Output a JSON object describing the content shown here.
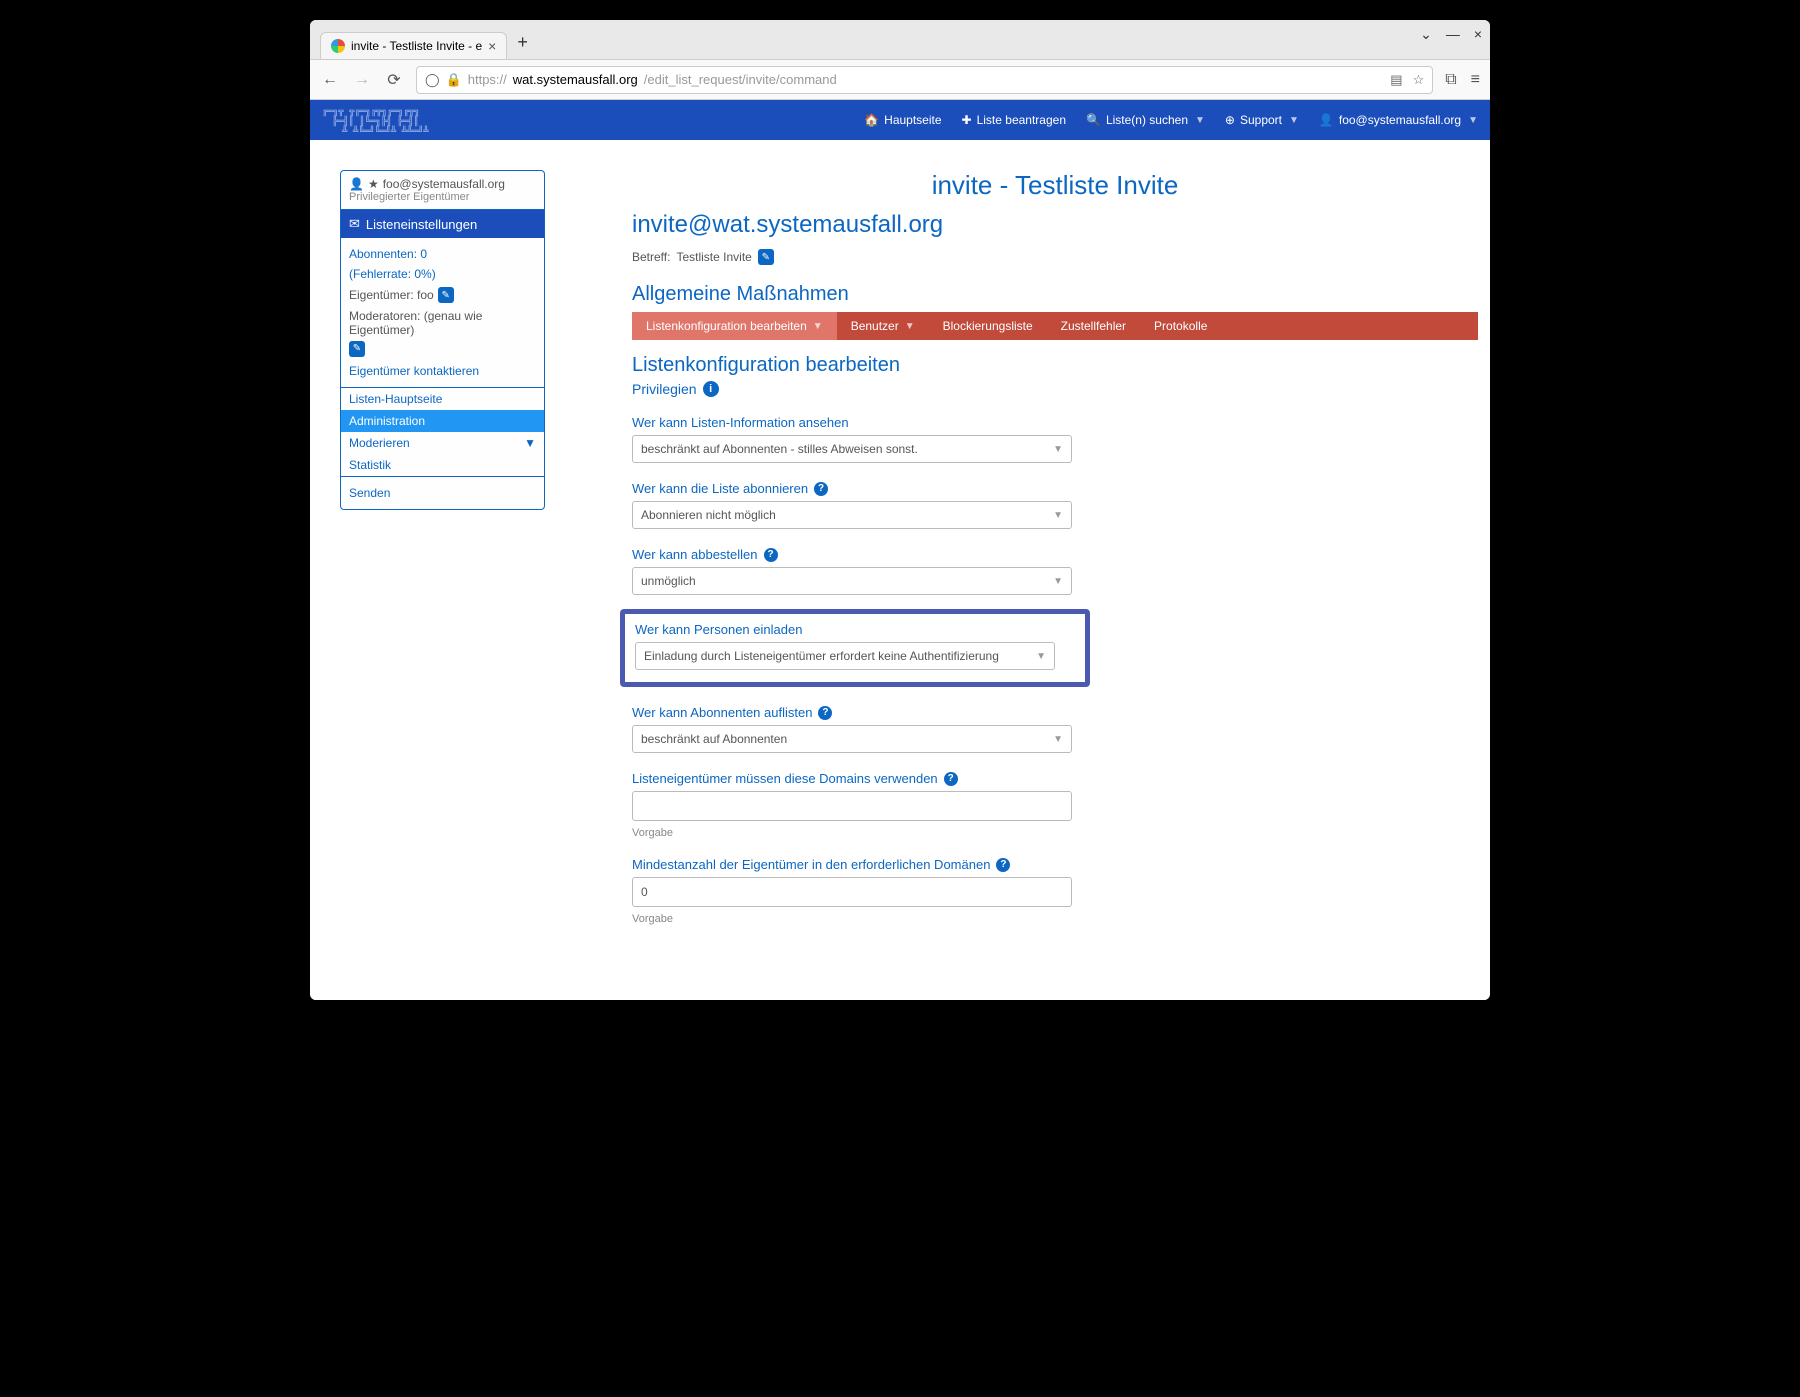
{
  "tab": {
    "title": "invite - Testliste Invite - e"
  },
  "url": {
    "prefix": "https://",
    "host": "wat.systemausfall.org",
    "path": "/edit_list_request/invite/command"
  },
  "nav": {
    "home": "Hauptseite",
    "request": "Liste beantragen",
    "search": "Liste(n) suchen",
    "support": "Support",
    "user": "foo@systemausfall.org"
  },
  "sidebar": {
    "user_email": "foo@systemausfall.org",
    "user_role": "Privilegierter Eigentümer",
    "settings_header": "Listeneinstellungen",
    "subs": "Abonnenten: 0",
    "error": "(Fehlerrate: 0%)",
    "owner": "Eigentümer: foo",
    "moderators": "Moderatoren: (genau wie Eigentümer)",
    "contact": "Eigentümer kontaktieren",
    "nav": {
      "main": "Listen-Hauptseite",
      "admin": "Administration",
      "moderate": "Moderieren",
      "stats": "Statistik"
    },
    "send": "Senden"
  },
  "main": {
    "page_title": "invite - Testliste Invite",
    "list_email": "invite@wat.systemausfall.org",
    "betreff_label": "Betreff:",
    "betreff_value": "Testliste Invite",
    "section": "Allgemeine Maßnahmen",
    "tabs": {
      "config": "Listenkonfiguration bearbeiten",
      "users": "Benutzer",
      "block": "Blockierungsliste",
      "bounces": "Zustellfehler",
      "logs": "Protokolle"
    },
    "config_title": "Listenkonfiguration bearbeiten",
    "subtitle": "Privilegien",
    "fields": {
      "view_info": {
        "label": "Wer kann Listen-Information ansehen",
        "value": "beschränkt auf Abonnenten - stilles Abweisen sonst."
      },
      "subscribe": {
        "label": "Wer kann die Liste abonnieren",
        "value": "Abonnieren nicht möglich"
      },
      "unsubscribe": {
        "label": "Wer kann abbestellen",
        "value": "unmöglich"
      },
      "invite": {
        "label": "Wer kann Personen einladen",
        "value": "Einladung durch Listeneigentümer erfordert keine Authentifizierung"
      },
      "list_subs": {
        "label": "Wer kann Abonnenten auflisten",
        "value": "beschränkt auf Abonnenten"
      },
      "domains": {
        "label": "Listeneigentümer müssen diese Domains verwenden",
        "value": "",
        "hint": "Vorgabe"
      },
      "min_owners": {
        "label": "Mindestanzahl der Eigentümer in den erforderlichen Domänen",
        "value": "0",
        "hint": "Vorgabe"
      }
    }
  }
}
